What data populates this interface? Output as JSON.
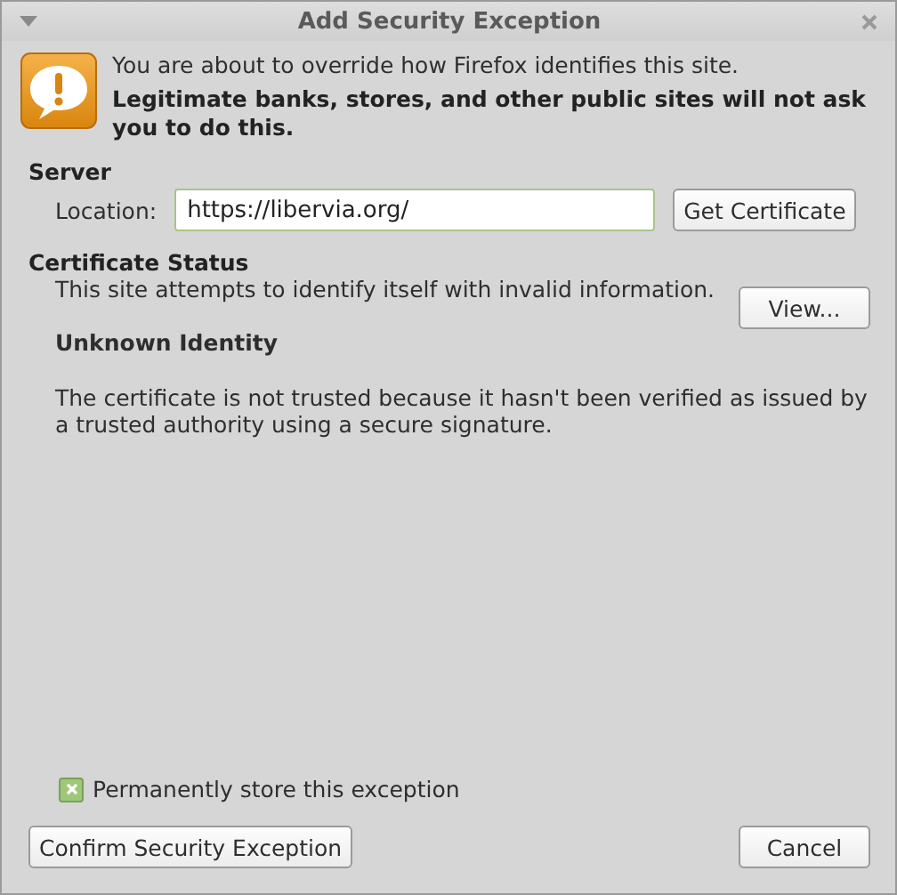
{
  "window": {
    "title": "Add Security Exception"
  },
  "intro": {
    "text": "You are about to override how Firefox identifies this site.",
    "warning": "Legitimate banks, stores, and other public sites will not ask you to do this."
  },
  "server": {
    "heading": "Server",
    "location_label": "Location:",
    "location_value": "https://libervia.org/",
    "get_button": "Get Certificate"
  },
  "status": {
    "heading": "Certificate Status",
    "summary": "This site attempts to identify itself with invalid information.",
    "view_button": "View...",
    "problem_title": "Unknown Identity",
    "problem_text": "The certificate is not trusted because it hasn't been verified as issued by a trusted authority using a secure signature."
  },
  "permanent": {
    "label": "Permanently store this exception",
    "checked": true
  },
  "buttons": [
    {
      "label": "Confirm Security Exception"
    },
    {
      "label": "Cancel"
    }
  ]
}
